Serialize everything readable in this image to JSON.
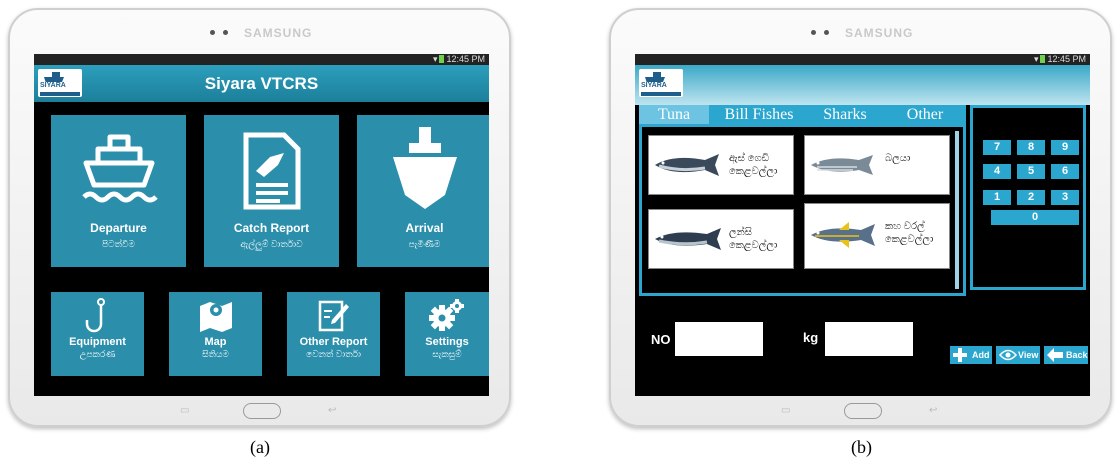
{
  "device": {
    "brand": "SAMSUNG"
  },
  "captions": {
    "a": "(a)",
    "b": "(b)"
  },
  "screen_a": {
    "status_time": "12:45 PM",
    "app_title": "Siyara VTCRS",
    "logo_text": "SIYARA",
    "tiles": [
      {
        "label": "Departure",
        "sub": "පිටත්වීම",
        "icon": "ship-departure-icon"
      },
      {
        "label": "Catch Report",
        "sub": "ඇල්ලුම් වාර්තාව",
        "icon": "catch-report-icon"
      },
      {
        "label": "Arrival",
        "sub": "පැමිණීම",
        "icon": "ship-arrival-icon"
      },
      {
        "label": "Equipment",
        "sub": "උපකරණ",
        "icon": "hook-icon"
      },
      {
        "label": "Map",
        "sub": "සිතියම",
        "icon": "map-icon"
      },
      {
        "label": "Other Report",
        "sub": "වෙනත් වාර්තා",
        "icon": "edit-report-icon"
      },
      {
        "label": "Settings",
        "sub": "සැකසුම්",
        "icon": "gear-icon"
      }
    ]
  },
  "screen_b": {
    "status_time": "12:45 PM",
    "logo_text": "SIYARA",
    "tabs": [
      "Tuna",
      "Bill Fishes",
      "Sharks",
      "Other"
    ],
    "fish": [
      {
        "name": "ඇස් ගෙඩි කෙළවල්ලා",
        "icon": "bigeye-tuna-icon"
      },
      {
        "name": "බලයා",
        "icon": "skipjack-tuna-icon"
      },
      {
        "name": "ලන්සි කෙළවල්ලා",
        "icon": "longtail-tuna-icon"
      },
      {
        "name": "කහ වරල් කෙළවල්ලා",
        "icon": "yellowfin-tuna-icon"
      }
    ],
    "keypad": [
      "7",
      "8",
      "9",
      "4",
      "5",
      "6",
      "1",
      "2",
      "3",
      "0"
    ],
    "fields": {
      "no_label": "NO",
      "no_value": "",
      "kg_label": "kg",
      "kg_value": ""
    },
    "buttons": {
      "add": "Add",
      "view": "View",
      "back": "Back"
    },
    "colors": {
      "accent": "#2aa6cf",
      "tile": "#2b8fab",
      "background": "#000000"
    }
  }
}
